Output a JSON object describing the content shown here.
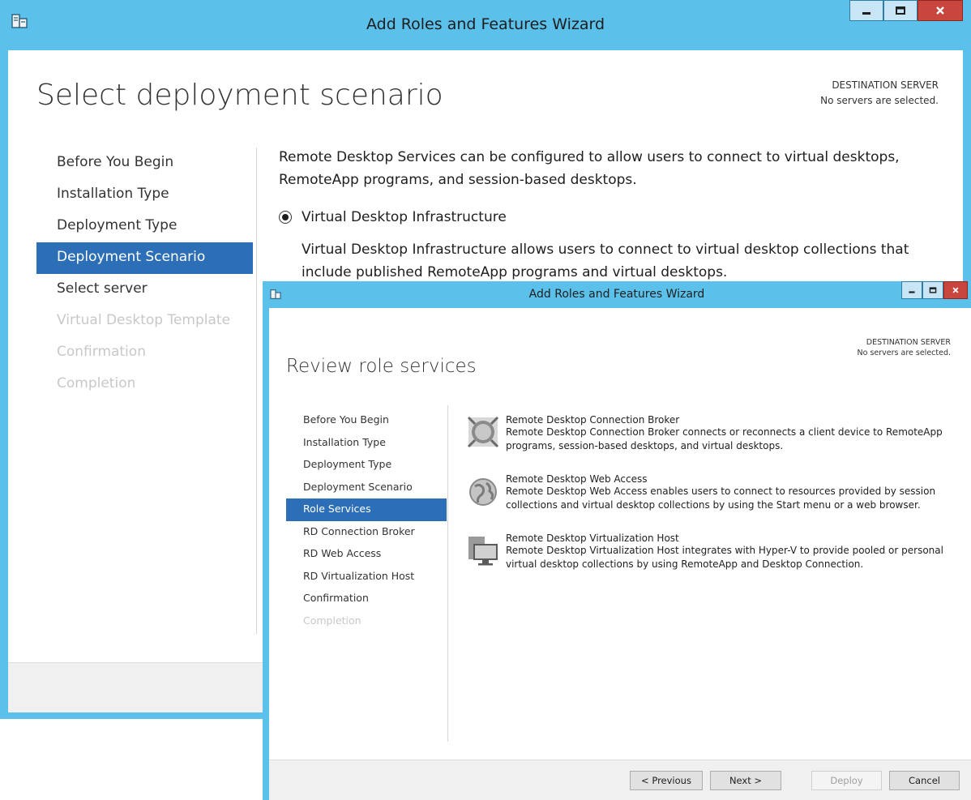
{
  "back_window": {
    "title": "Add Roles and Features Wizard",
    "page_title": "Select deployment scenario",
    "destination_label": "DESTINATION SERVER",
    "destination_value": "No servers are selected.",
    "nav": [
      {
        "label": "Before You Begin",
        "state": "normal"
      },
      {
        "label": "Installation Type",
        "state": "normal"
      },
      {
        "label": "Deployment Type",
        "state": "normal"
      },
      {
        "label": "Deployment Scenario",
        "state": "active"
      },
      {
        "label": "Select server",
        "state": "normal"
      },
      {
        "label": "Virtual Desktop Template",
        "state": "disabled"
      },
      {
        "label": "Confirmation",
        "state": "disabled"
      },
      {
        "label": "Completion",
        "state": "disabled"
      }
    ],
    "intro": "Remote Desktop Services can be configured to allow users to connect to virtual desktops, RemoteApp programs, and session-based desktops.",
    "option_label": "Virtual Desktop Infrastructure",
    "option_selected": true,
    "option_desc": "Virtual Desktop Infrastructure allows users to connect to virtual desktop collections that include published RemoteApp programs and virtual desktops."
  },
  "front_window": {
    "title": "Add Roles and Features Wizard",
    "page_title": "Review role services",
    "destination_label": "DESTINATION SERVER",
    "destination_value": "No servers are selected.",
    "nav": [
      {
        "label": "Before You Begin",
        "state": "normal"
      },
      {
        "label": "Installation Type",
        "state": "normal"
      },
      {
        "label": "Deployment Type",
        "state": "normal"
      },
      {
        "label": "Deployment Scenario",
        "state": "normal"
      },
      {
        "label": "Role Services",
        "state": "active"
      },
      {
        "label": "RD Connection Broker",
        "state": "normal"
      },
      {
        "label": "RD Web Access",
        "state": "normal"
      },
      {
        "label": "RD Virtualization Host",
        "state": "normal"
      },
      {
        "label": "Confirmation",
        "state": "normal"
      },
      {
        "label": "Completion",
        "state": "disabled"
      }
    ],
    "roles": [
      {
        "icon": "connection-broker-icon",
        "name": "Remote Desktop Connection Broker",
        "desc": "Remote Desktop Connection Broker connects or reconnects a client device to RemoteApp programs, session-based desktops, and virtual desktops."
      },
      {
        "icon": "web-access-globe-icon",
        "name": "Remote Desktop Web Access",
        "desc": "Remote Desktop Web Access enables users to connect to resources provided by session collections and virtual desktop collections by using the Start menu or a web browser."
      },
      {
        "icon": "virtualization-host-icon",
        "name": "Remote Desktop Virtualization Host",
        "desc": "Remote Desktop Virtualization Host integrates with Hyper-V to provide pooled or personal virtual desktop collections by using RemoteApp and Desktop Connection."
      }
    ],
    "buttons": {
      "previous": "< Previous",
      "next": "Next >",
      "deploy": "Deploy",
      "cancel": "Cancel",
      "deploy_enabled": false
    }
  },
  "colors": {
    "frame": "#5bc0ea",
    "active_nav": "#2d6fb6",
    "close_button": "#c8463d"
  }
}
